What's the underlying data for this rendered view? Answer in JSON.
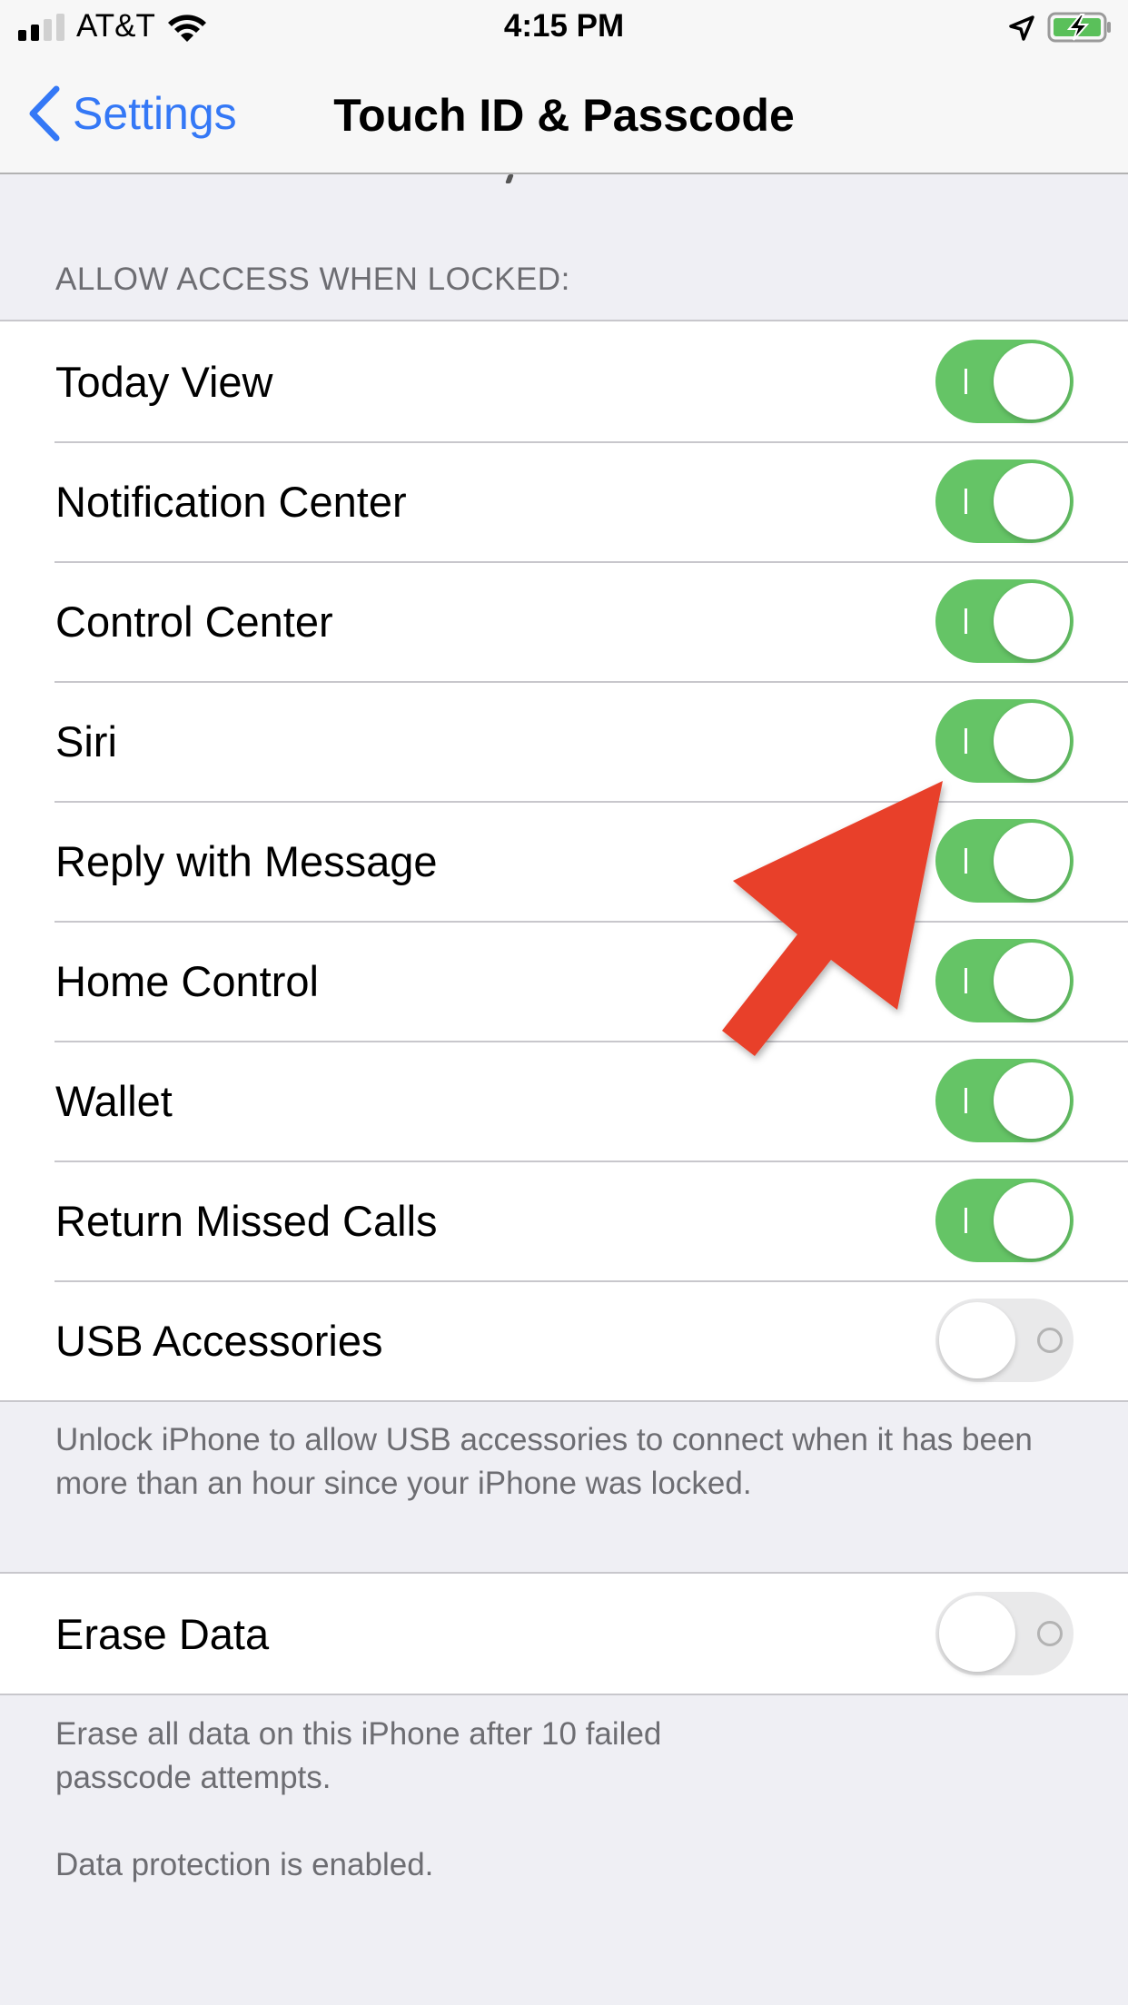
{
  "status_bar": {
    "signal_bars_filled": 2,
    "signal_bars_total": 4,
    "carrier": "AT&T",
    "wifi_icon": "wifi-icon",
    "time": "4:15 PM",
    "location_icon": "location-arrow-icon",
    "battery_icon": "battery-charging-icon",
    "battery_color": "#5ac05a"
  },
  "nav": {
    "back_label": "Settings",
    "back_icon": "chevron-left-icon",
    "title": "Touch ID & Passcode",
    "accent": "#3478f6"
  },
  "access_section": {
    "header": "ALLOW ACCESS WHEN LOCKED:",
    "items": [
      {
        "label": "Today View",
        "on": true
      },
      {
        "label": "Notification Center",
        "on": true
      },
      {
        "label": "Control Center",
        "on": true
      },
      {
        "label": "Siri",
        "on": true
      },
      {
        "label": "Reply with Message",
        "on": true
      },
      {
        "label": "Home Control",
        "on": true
      },
      {
        "label": "Wallet",
        "on": true
      },
      {
        "label": "Return Missed Calls",
        "on": true
      },
      {
        "label": "USB Accessories",
        "on": false
      }
    ],
    "footer": "Unlock iPhone to allow USB accessories to connect when it has been more than an hour since your iPhone was locked."
  },
  "erase_section": {
    "items": [
      {
        "label": "Erase Data",
        "on": false
      }
    ],
    "footer_line1": "Erase all data on this iPhone after 10 failed passcode attempts.",
    "footer_line2": "Data protection is enabled."
  },
  "annotation": {
    "type": "arrow",
    "color": "#e8402a",
    "points_to": "Siri toggle"
  },
  "colors": {
    "toggle_on": "#65c466",
    "toggle_off": "#e9e9ea",
    "background": "#efeff4"
  }
}
